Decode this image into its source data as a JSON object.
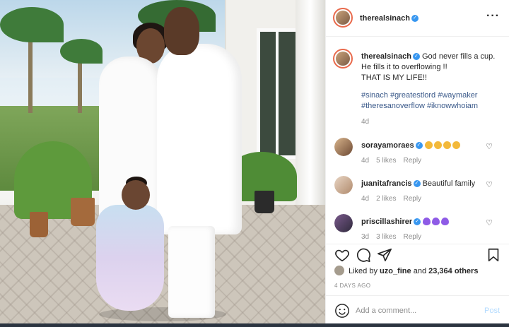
{
  "post": {
    "author": "therealsinach",
    "caption_lines": [
      "God never fills a cup.",
      "He fills it to overflowing !!",
      "THAT IS MY LIFE!!"
    ],
    "hashtags": "#sinach #greatestlord #waymaker #theresanoverflow #iknowwhoiam",
    "caption_time": "4d"
  },
  "comments": [
    {
      "user": "sorayamoraes",
      "text": "",
      "emoji": [
        "clap",
        "clap",
        "clap",
        "clap"
      ],
      "time": "4d",
      "likes": "5 likes",
      "reply": "Reply"
    },
    {
      "user": "juanitafrancis",
      "text": "Beautiful family",
      "emoji": [],
      "time": "4d",
      "likes": "2 likes",
      "reply": "Reply"
    },
    {
      "user": "priscillashirer",
      "text": "",
      "emoji": [
        "purple-heart",
        "purple-heart",
        "purple-heart"
      ],
      "time": "3d",
      "likes": "3 likes",
      "reply": "Reply"
    }
  ],
  "likes": {
    "prefix": "Liked by ",
    "user": "uzo_fine",
    "mid": " and ",
    "count": "23,364 others"
  },
  "post_date": "4 DAYS AGO",
  "add_comment": {
    "placeholder": "Add a comment...",
    "post_label": "Post"
  },
  "colors": {
    "verified": "#3897f0",
    "link": "#3b5a8a",
    "muted": "#8e8e8e",
    "post_disabled": "#b3dbff",
    "story_ring": "#e96a4c"
  },
  "icons": [
    "more-icon",
    "heart-icon",
    "comment-icon",
    "share-icon",
    "bookmark-icon",
    "emoji-icon"
  ]
}
